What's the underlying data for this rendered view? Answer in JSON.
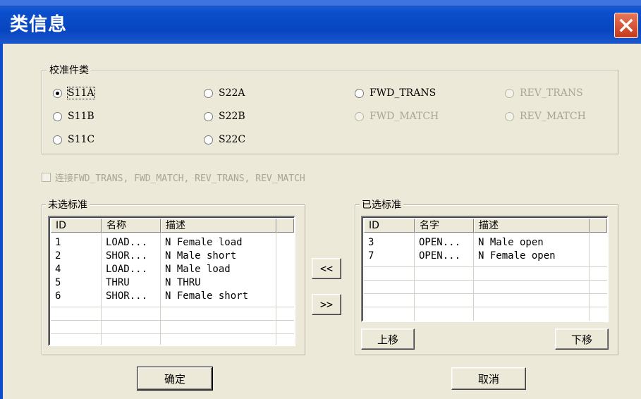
{
  "window": {
    "title": "类信息"
  },
  "calibration_group": {
    "label": "校准件类",
    "options": [
      {
        "label": "S11A",
        "selected": true,
        "enabled": true
      },
      {
        "label": "S22A",
        "selected": false,
        "enabled": true
      },
      {
        "label": "FWD_TRANS",
        "selected": false,
        "enabled": true
      },
      {
        "label": "REV_TRANS",
        "selected": false,
        "enabled": false
      },
      {
        "label": "S11B",
        "selected": false,
        "enabled": true
      },
      {
        "label": "S22B",
        "selected": false,
        "enabled": true
      },
      {
        "label": "FWD_MATCH",
        "selected": false,
        "enabled": false
      },
      {
        "label": "REV_MATCH",
        "selected": false,
        "enabled": false
      },
      {
        "label": "S11C",
        "selected": false,
        "enabled": true
      },
      {
        "label": "S22C",
        "selected": false,
        "enabled": true
      }
    ]
  },
  "link_checkbox": {
    "label": "连接FWD_TRANS, FWD_MATCH, REV_TRANS, REV_MATCH",
    "checked": false,
    "enabled": false
  },
  "unselected": {
    "label": "未选标准",
    "columns": [
      "ID",
      "名称",
      "描述"
    ],
    "rows": [
      [
        "1",
        "LOAD...",
        "N Female load"
      ],
      [
        "2",
        "SHOR...",
        "N Male short"
      ],
      [
        "4",
        "LOAD...",
        "N Male load"
      ],
      [
        "5",
        "THRU",
        "N THRU"
      ],
      [
        "6",
        "SHOR...",
        "N Female short"
      ]
    ]
  },
  "selected": {
    "label": "已选标准",
    "columns": [
      "ID",
      "名字",
      "描述"
    ],
    "rows": [
      [
        "3",
        "OPEN...",
        "N Male open"
      ],
      [
        "7",
        "OPEN...",
        "N Female open"
      ]
    ],
    "move_up_label": "上移",
    "move_down_label": "下移"
  },
  "transfer": {
    "left_label": "<<",
    "right_label": ">>"
  },
  "footer": {
    "ok_label": "确定",
    "cancel_label": "取消"
  }
}
